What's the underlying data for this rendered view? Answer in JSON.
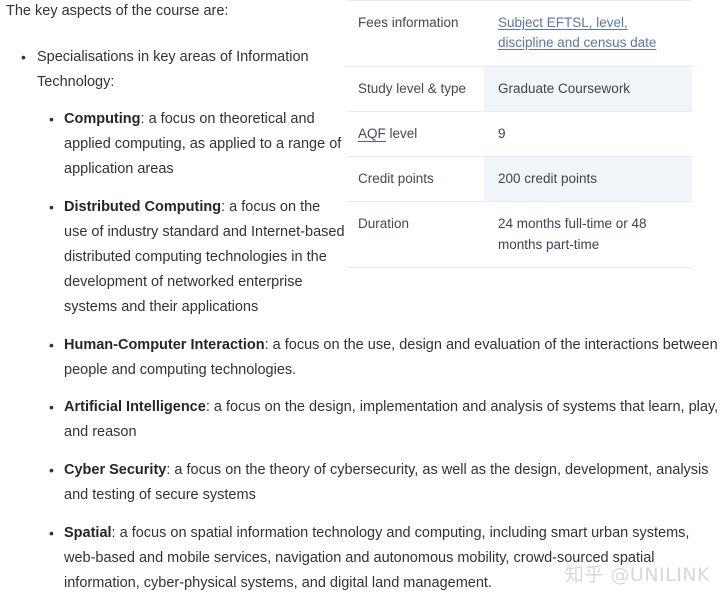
{
  "intro": {
    "text": "The key aspects of the course are:"
  },
  "info_table": {
    "rows": [
      {
        "label": "Fees information",
        "value": "Subject EFTSL, level, discipline and census date",
        "is_link": true,
        "shaded": false
      },
      {
        "label": "Study level & type",
        "value": "Graduate Coursework",
        "is_link": false,
        "shaded": true
      },
      {
        "label": "AQF level",
        "label_abbr": "AQF",
        "label_rest": " level",
        "value": "9",
        "is_link": false,
        "shaded": false
      },
      {
        "label": "Credit points",
        "value": "200 credit points",
        "is_link": false,
        "shaded": true
      },
      {
        "label": "Duration",
        "value": "24 months full-time or 48 months part-time",
        "is_link": false,
        "shaded": false
      }
    ],
    "link_color": "#5c7799",
    "shaded_row_color": "#f1f4f9",
    "border_color": "#e7ebf0"
  },
  "aspects": {
    "items": [
      {
        "text": "Specialisations in key areas of Information Technology:",
        "children": [
          {
            "term": "Computing",
            "description": ": a focus on theoretical and applied computing, as applied to a range of application areas"
          },
          {
            "term": "Distributed Computing",
            "description": ": a focus on the use of industry standard and Internet-based distributed computing technologies in the development of networked enterprise systems and their applications"
          },
          {
            "term": "Human-Computer Interaction",
            "description": ": a focus on the use, design and evaluation of the interactions between people and computing technologies."
          },
          {
            "term": "Artificial Intelligence",
            "description": ": a focus on the design, implementation and analysis of systems that learn, play, and reason"
          },
          {
            "term": "Cyber Security",
            "description": ": a focus on the theory of cybersecurity, as well as the design, development, analysis and testing of secure systems"
          },
          {
            "term": "Spatial",
            "description": ": a focus on spatial information technology and computing, including smart urban systems, web-based and mobile services, navigation and autonomous mobility, crowd-sourced spatial information, cyber-physical systems, and digital land management."
          }
        ]
      }
    ]
  },
  "watermark": {
    "text": "知乎 @UNILINK"
  }
}
